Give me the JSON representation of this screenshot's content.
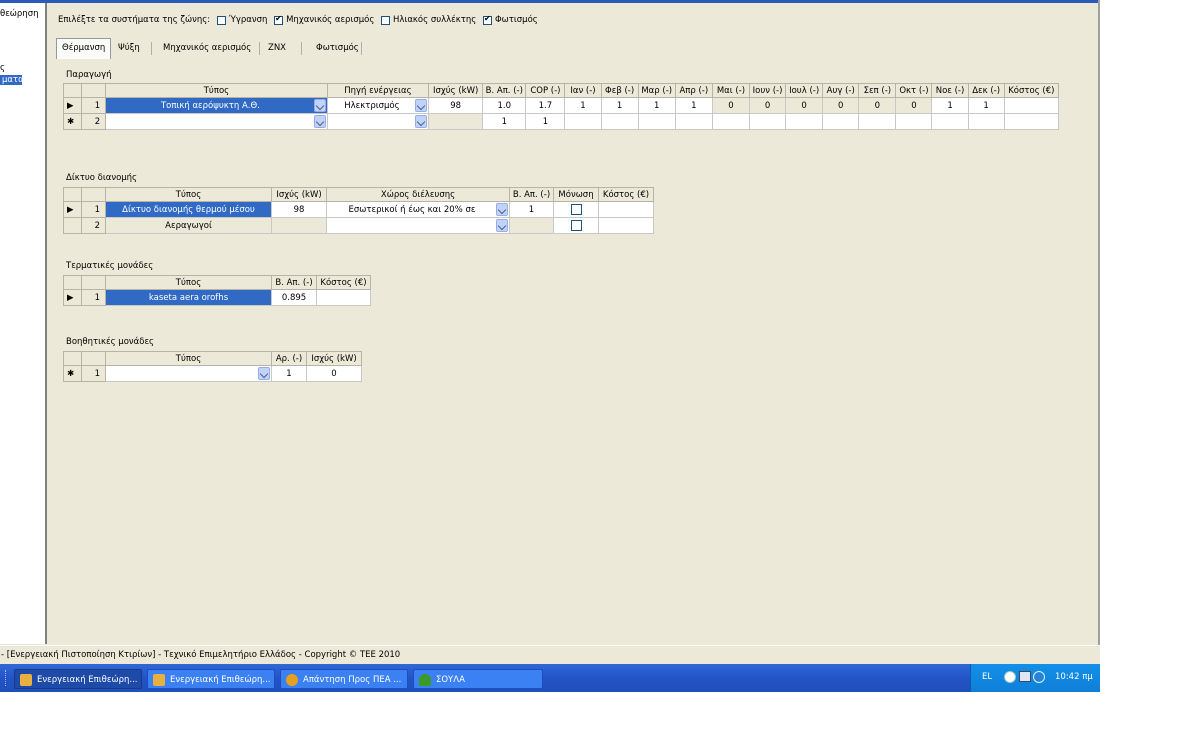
{
  "left_panel": {
    "items": [
      "θεώρηση",
      "ς",
      "ματα"
    ]
  },
  "zone_systems": {
    "prompt": "Επιλέξτε τα συστήματα της ζώνης:",
    "options": [
      {
        "label": "Ύγρανση",
        "checked": false
      },
      {
        "label": "Μηχανικός αερισμός",
        "checked": true
      },
      {
        "label": "Ηλιακός συλλέκτης",
        "checked": false
      },
      {
        "label": "Φωτισμός",
        "checked": true
      }
    ]
  },
  "tabs": [
    "Θέρμανση",
    "Ψύξη",
    "Μηχανικός αερισμός",
    "ΖΝΧ",
    "Φωτισμός"
  ],
  "production": {
    "title": "Παραγωγή",
    "headers": [
      "Τύπος",
      "Πηγή ενέργειας",
      "Ισχύς (kW)",
      "Β. Απ. (-)",
      "COP (-)",
      "Ιαν (-)",
      "Φεβ (-)",
      "Μαρ (-)",
      "Απρ (-)",
      "Μαι (-)",
      "Ιουν (-)",
      "Ιουλ (-)",
      "Αυγ (-)",
      "Σεπ (-)",
      "Οκτ (-)",
      "Νοε (-)",
      "Δεκ (-)",
      "Κόστος (€)"
    ],
    "rows": [
      {
        "marker": "▶",
        "num": "1",
        "cells": [
          "Τοπική αερόψυκτη Α.Θ.",
          "Ηλεκτρισμός",
          "98",
          "1.0",
          "1.7",
          "1",
          "1",
          "1",
          "1",
          "0",
          "0",
          "0",
          "0",
          "0",
          "0",
          "1",
          "1",
          ""
        ]
      },
      {
        "marker": "✱",
        "num": "2",
        "cells": [
          "",
          "",
          "",
          "1",
          "1",
          "",
          "",
          "",
          "",
          "",
          "",
          "",
          "",
          "",
          "",
          "",
          "",
          ""
        ]
      }
    ]
  },
  "distribution": {
    "title": "Δίκτυο διανομής",
    "headers": [
      "Τύπος",
      "Ισχύς (kW)",
      "Χώρος διέλευσης",
      "Β. Απ. (-)",
      "Μόνωση",
      "Κόστος (€)"
    ],
    "rows": [
      {
        "marker": "▶",
        "num": "1",
        "cells": [
          "Δίκτυο διανομής θερμού μέσου",
          "98",
          "Εσωτερικοί ή έως και 20% σε",
          "1",
          "",
          ""
        ],
        "insulation": false
      },
      {
        "marker": "",
        "num": "2",
        "cells": [
          "Αεραγωγοί",
          "",
          "",
          "",
          "",
          ""
        ],
        "insulation": false
      }
    ]
  },
  "terminal": {
    "title": "Τερματικές μονάδες",
    "headers": [
      "Τύπος",
      "Β. Απ. (-)",
      "Κόστος (€)"
    ],
    "rows": [
      {
        "marker": "▶",
        "num": "1",
        "cells": [
          "kaseta aera orofhs",
          "0.895",
          ""
        ]
      }
    ]
  },
  "auxiliary": {
    "title": "Βοηθητικές μονάδες",
    "headers": [
      "Τύπος",
      "Αρ. (-)",
      "Ισχύς (kW)"
    ],
    "rows": [
      {
        "marker": "✱",
        "num": "1",
        "cells": [
          "",
          "1",
          "0"
        ]
      }
    ]
  },
  "status_bar": "- [Ενεργειακή Πιστοποίηση Κτιρίων] - Τεχνικό Επιμελητήριο Ελλάδος - Copyright © TEE 2010",
  "taskbar": {
    "buttons": [
      {
        "label": "Ενεργειακή Επιθεώρη...",
        "active": true,
        "icon_color": "#e8b040"
      },
      {
        "label": "Ενεργειακή Επιθεώρη...",
        "active": false,
        "icon_color": "#e8b040"
      },
      {
        "label": "Απάντηση Προς ΠΕΑ ...",
        "active": false,
        "icon_color": "#e6a020"
      },
      {
        "label": "ΣΟΥΛΑ",
        "active": false,
        "icon_color": "#3a9a2a"
      }
    ],
    "language": "EL",
    "clock": "10:42 πμ"
  }
}
